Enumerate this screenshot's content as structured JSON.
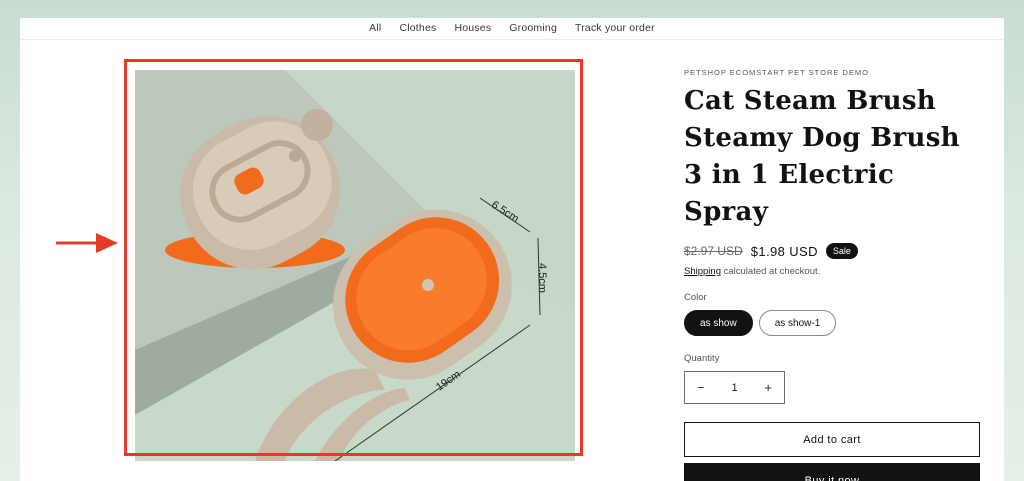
{
  "nav": {
    "items": [
      "All",
      "Clothes",
      "Houses",
      "Grooming",
      "Track your order"
    ]
  },
  "product": {
    "vendor": "PETSHOP ECOMSTART PET STORE DEMO",
    "title": "Cat Steam Brush Steamy Dog Brush 3 in 1 Electric Spray",
    "compare_price": "$2.97 USD",
    "price": "$1.98 USD",
    "badge": "Sale",
    "shipping_link": "Shipping",
    "shipping_text": " calculated at checkout.",
    "color_label": "Color",
    "colors": [
      "as show",
      "as show-1"
    ],
    "selected_color": "as show",
    "quantity_label": "Quantity",
    "quantity": "1",
    "add_to_cart": "Add to cart",
    "buy_now": "Buy it now"
  },
  "image": {
    "dimension_width": "6.5cm",
    "dimension_height": "4.5cm",
    "dimension_length": "19cm"
  },
  "icons": {
    "minus": "−",
    "plus": "+"
  },
  "colors": {
    "highlight": "#e53b26",
    "brush_orange": "#f26b1d",
    "brush_body": "#cbbfae",
    "photo_bg": "#c5d5c6",
    "button_dark": "#121212"
  }
}
